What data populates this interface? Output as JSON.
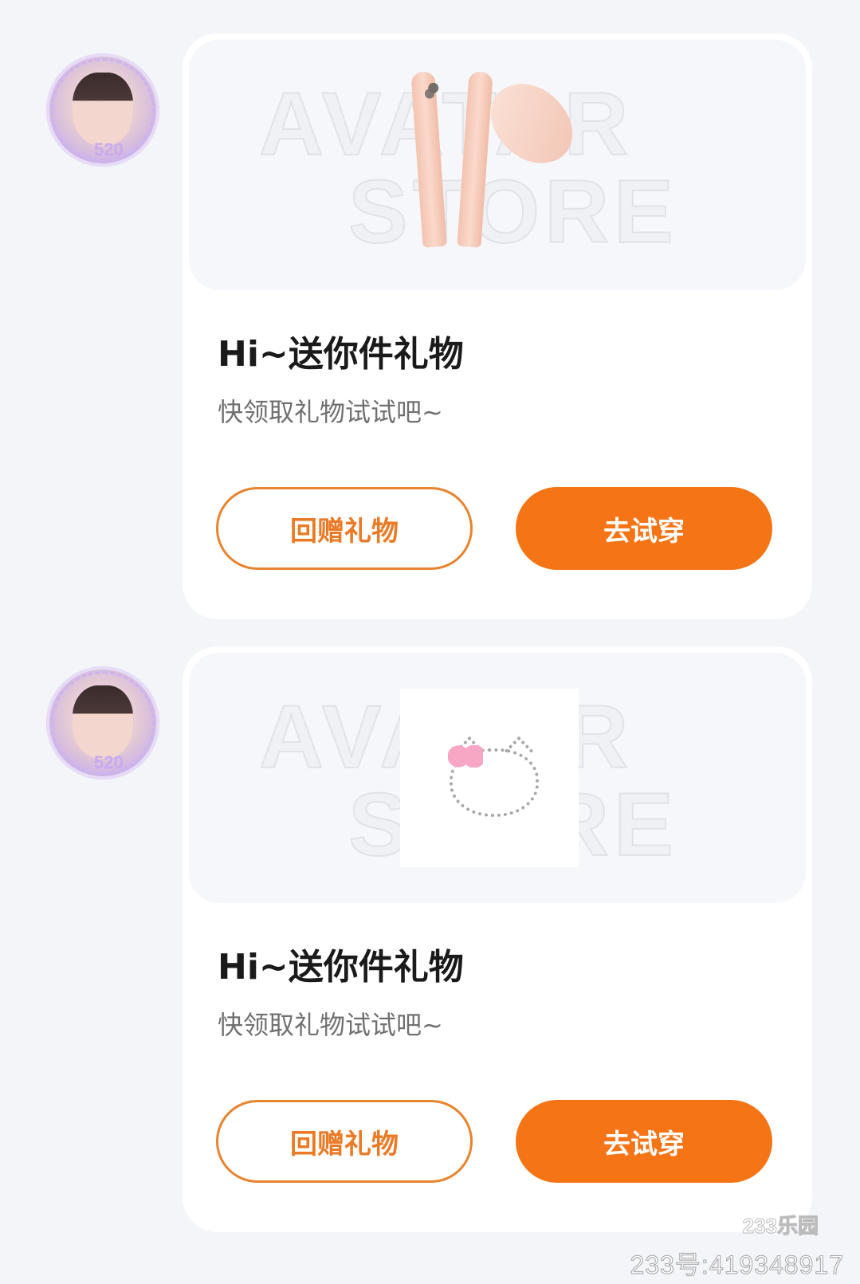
{
  "messages": [
    {
      "avatar_badge": "520",
      "preview_watermark": [
        "AVATAR",
        "STORE"
      ],
      "title": "Hi~送你件礼物",
      "subtitle": "快领取礼物试试吧~",
      "return_gift_label": "回赠礼物",
      "try_on_label": "去试穿"
    },
    {
      "avatar_badge": "520",
      "preview_watermark": [
        "AVATAR",
        "STORE"
      ],
      "title": "Hi~送你件礼物",
      "subtitle": "快领取礼物试试吧~",
      "return_gift_label": "回赠礼物",
      "try_on_label": "去试穿"
    }
  ],
  "colors": {
    "accent": "#f57416",
    "background": "#f3f5f8",
    "card": "#ffffff"
  },
  "watermark": {
    "logo": "233乐园",
    "id_text": "233号:419348917"
  }
}
